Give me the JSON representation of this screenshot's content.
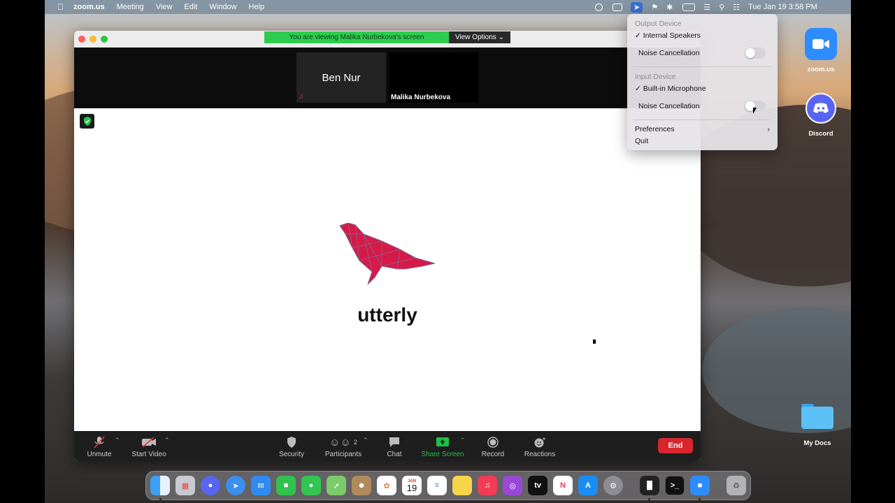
{
  "menubar": {
    "app_name": "zoom.us",
    "items": [
      "Meeting",
      "View",
      "Edit",
      "Window",
      "Help"
    ],
    "datetime": "Tue Jan 19  3:58 PM"
  },
  "zoom": {
    "banner_text": "You are viewing Malika Nurbekova's screen",
    "view_options_label": "View Options",
    "participants": [
      {
        "name": "Ben Nur"
      },
      {
        "name": "Malika Nurbekova"
      }
    ],
    "shared_content": {
      "brand_text": "utterly",
      "brand_color": "#d7194a"
    },
    "toolbar": {
      "unmute": "Unmute",
      "start_video": "Start Video",
      "security": "Security",
      "participants": "Participants",
      "participants_count": "2",
      "chat": "Chat",
      "share_screen": "Share Screen",
      "record": "Record",
      "reactions": "Reactions",
      "end": "End"
    }
  },
  "dropdown": {
    "output_header": "Output Device",
    "output_selected": "Internal Speakers",
    "output_noise": "Noise Cancellation",
    "input_header": "Input Device",
    "input_selected": "Built-in Microphone",
    "input_noise": "Noise Cancellation",
    "preferences": "Preferences",
    "quit": "Quit"
  },
  "desktop": {
    "icons": [
      {
        "label": "zoom.us"
      },
      {
        "label": "Discord"
      },
      {
        "label": "My Docs"
      }
    ]
  },
  "dock": {
    "calendar_month": "JAN",
    "calendar_day": "19",
    "apps": [
      "Finder",
      "Launchpad",
      "Discord",
      "Safari",
      "Mail",
      "FaceTime",
      "Messages",
      "Maps",
      "Contacts",
      "Photos",
      "Calendar",
      "Reminders",
      "Notes",
      "Music",
      "Podcasts",
      "TV",
      "News",
      "App Store",
      "System Preferences",
      "Piano",
      "Terminal",
      "Zoom",
      "Trash"
    ]
  },
  "colors": {
    "zoom_blue": "#2d8cff",
    "share_green": "#1ec04a",
    "end_red": "#d7262d",
    "banner_green": "#2ecc4e"
  }
}
